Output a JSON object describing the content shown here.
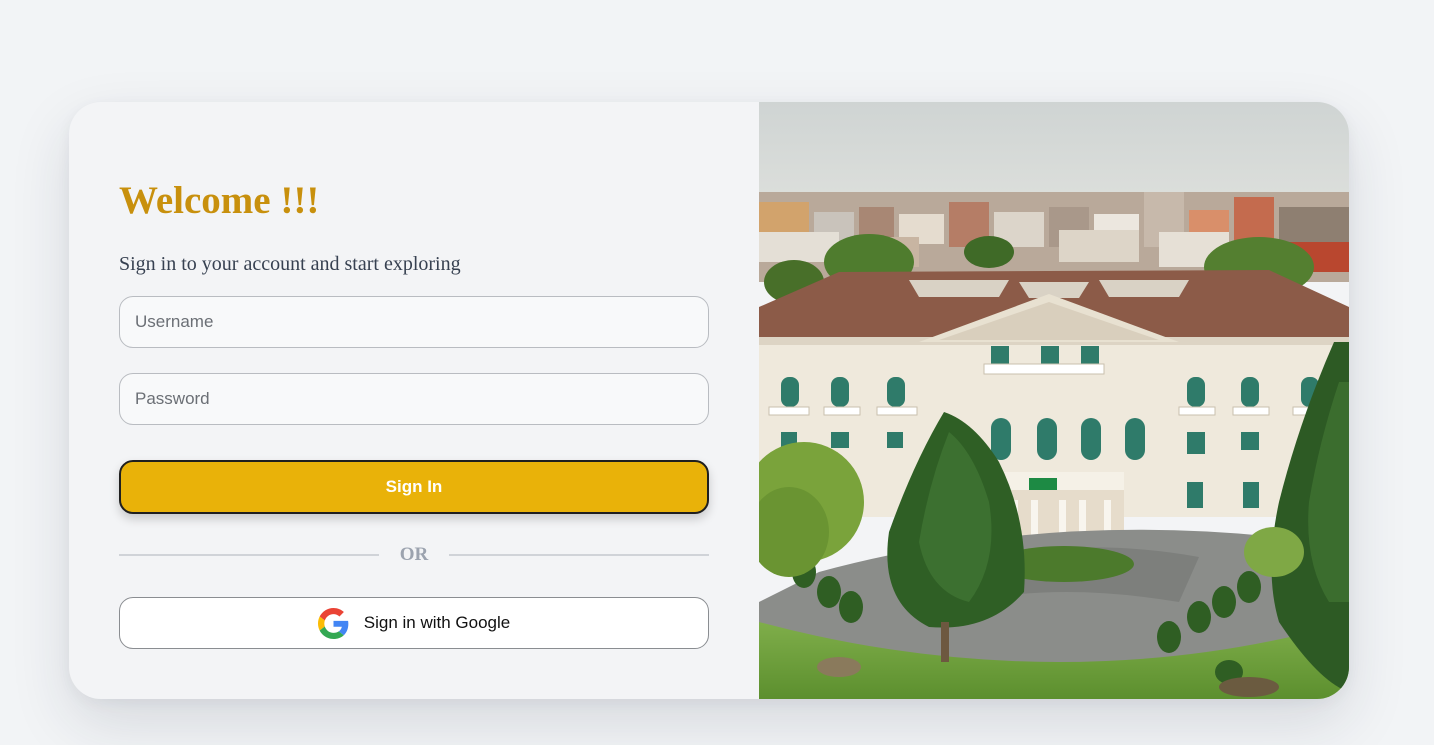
{
  "login": {
    "title": "Welcome !!!",
    "subtitle": "Sign in to your account and start exploring",
    "username_placeholder": "Username",
    "username_value": "",
    "password_placeholder": "Password",
    "password_value": "",
    "signin_label": "Sign In",
    "divider_label": "OR",
    "google_label": "Sign in with Google"
  },
  "colors": {
    "accent": "#e9b209",
    "title": "#c8900d",
    "page_background": "#f2f4f6"
  },
  "icons": {
    "google": "google-g-logo"
  },
  "image": {
    "subject": "aerial photo of a white neoclassical palace building surrounded by trees and a city"
  }
}
